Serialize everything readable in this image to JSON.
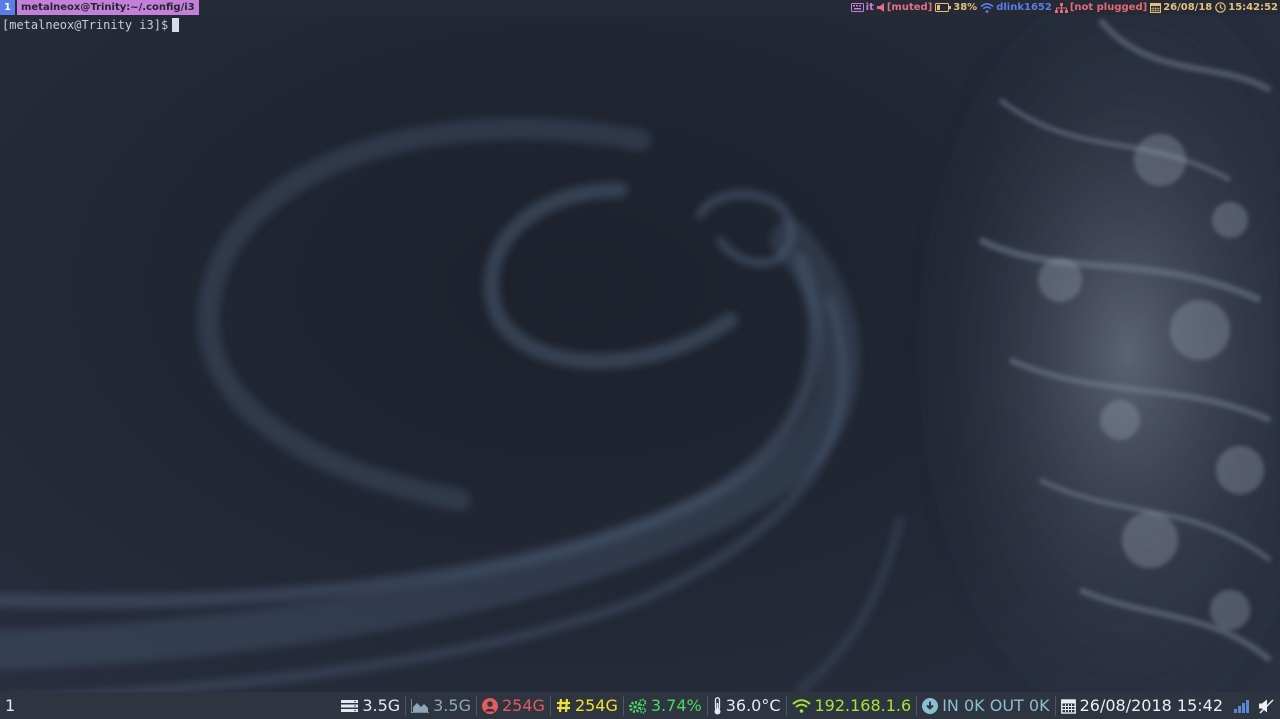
{
  "topbar": {
    "workspace": "1",
    "window_title": "metalneox@Trinity:~/.config/i3",
    "status": [
      {
        "id": "keyboard",
        "icon": "keyboard-icon",
        "text": "it",
        "color": "#c680d8"
      },
      {
        "id": "volume",
        "icon": "speaker-icon",
        "text": "[muted]",
        "color": "#e0708a"
      },
      {
        "id": "battery",
        "icon": "battery-icon",
        "text": "38%",
        "color": "#e5c07b"
      },
      {
        "id": "wifi",
        "icon": "wifi-icon",
        "text": "dlink1652",
        "color": "#5a7ee6"
      },
      {
        "id": "ethernet",
        "icon": "network-icon",
        "text": "[not plugged]",
        "color": "#e06c75"
      },
      {
        "id": "date",
        "icon": "calendar-icon",
        "text": "26/08/18",
        "color": "#e5c07b"
      },
      {
        "id": "time",
        "icon": "clock-icon",
        "text": "15:42:52",
        "color": "#e5c07b"
      }
    ]
  },
  "terminal": {
    "prompt": "[metalneox@Trinity i3]$"
  },
  "bottombar": {
    "workspace": "1",
    "items": [
      {
        "id": "memory",
        "icon": "memory-icon",
        "text": "3.5G",
        "color": "#e5e9f0"
      },
      {
        "id": "swap",
        "icon": "area-chart-icon",
        "text": "3.5G",
        "color": "#8fa6b8"
      },
      {
        "id": "home-disk",
        "icon": "user-icon",
        "text": "254G",
        "color": "#e05d5d"
      },
      {
        "id": "root-disk",
        "icon": "hash-icon",
        "text": "254G",
        "color": "#f2e232"
      },
      {
        "id": "cpu",
        "icon": "cogs-icon",
        "text": "3.74%",
        "color": "#4cd964"
      },
      {
        "id": "temperature",
        "icon": "thermometer-icon",
        "text": "36.0°C",
        "color": "#e5e9f0"
      },
      {
        "id": "ip",
        "icon": "wifi-icon",
        "text": "192.168.1.6",
        "color": "#a3e635"
      },
      {
        "id": "traffic",
        "icon": "download-icon",
        "text": "IN 0K OUT 0K",
        "color": "#88c0d0"
      },
      {
        "id": "datetime",
        "icon": "calendar-icon",
        "text": "26/08/2018 15:42",
        "color": "#eceff4"
      }
    ]
  },
  "colors": {
    "workspace_bg": "#5a7ee6",
    "title_bg": "#c480d8",
    "bar_bg": "#2e3440"
  }
}
